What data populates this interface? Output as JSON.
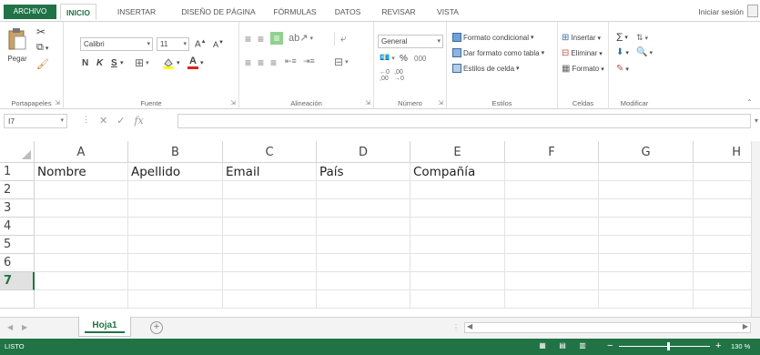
{
  "tabs": {
    "file": "ARCHIVO",
    "home": "INICIO",
    "insert": "INSERTAR",
    "page_layout": "DISEÑO DE PÁGINA",
    "formulas": "FÓRMULAS",
    "data": "DATOS",
    "review": "REVISAR",
    "view": "VISTA",
    "signin": "Iniciar sesión"
  },
  "ribbon": {
    "clipboard": {
      "paste": "Pegar",
      "label": "Portapapeles"
    },
    "font": {
      "name": "Calibri",
      "size": "11",
      "bold": "N",
      "italic": "K",
      "underline": "S",
      "label": "Fuente"
    },
    "alignment": {
      "label": "Alineación"
    },
    "number": {
      "format": "General",
      "percent": "%",
      "thousands": "000",
      "label": "Número"
    },
    "styles": {
      "conditional": "Formato condicional",
      "table": "Dar formato como tabla",
      "cell_styles": "Estilos de celda",
      "label": "Estilos"
    },
    "cells": {
      "insert": "Insertar",
      "delete": "Eliminar",
      "format": "Formato",
      "label": "Celdas"
    },
    "editing": {
      "label": "Modificar"
    }
  },
  "formula_bar": {
    "name_box": "I7",
    "fx": "fx",
    "content": ""
  },
  "grid": {
    "columns": [
      "A",
      "B",
      "C",
      "D",
      "E",
      "F",
      "G",
      "H"
    ],
    "rows": [
      "1",
      "2",
      "3",
      "4",
      "5",
      "6",
      "7"
    ],
    "selected_row": "7",
    "row1": {
      "A": "Nombre",
      "B": "Apellido",
      "C": "Email",
      "D": "País",
      "E": "Compañía"
    }
  },
  "sheets": {
    "active": "Hoja1",
    "add": "+"
  },
  "status": {
    "ready": "LISTO",
    "zoom": "130 %"
  },
  "colors": {
    "accent": "#217346",
    "header_gray": "#e1e1e1"
  },
  "icons": [
    "paste-icon",
    "cut-icon",
    "copy-icon",
    "format-painter-icon",
    "sum-icon",
    "sort-filter-icon",
    "find-icon",
    "fill-icon",
    "clear-icon"
  ]
}
